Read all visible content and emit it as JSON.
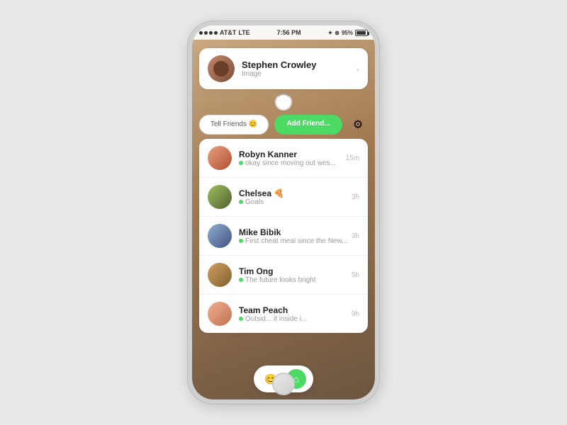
{
  "statusBar": {
    "carrier": "AT&T",
    "network": "LTE",
    "time": "7:56 PM",
    "battery": "95%"
  },
  "profileCard": {
    "name": "Stephen Crowley",
    "subtitle": "Image",
    "chevron": "›"
  },
  "actionButtons": {
    "tellFriends": "Tell Friends 😊",
    "addFriend": "Add Friend...",
    "settingsIcon": "⚙"
  },
  "friends": [
    {
      "name": "Robyn Kanner",
      "status": "okay since moving out wes...",
      "time": "15m",
      "avatarClass": "av-robyn"
    },
    {
      "name": "Chelsea 🍕",
      "status": "Goals",
      "time": "3h",
      "avatarClass": "av-chelsea"
    },
    {
      "name": "Mike Bibik",
      "status": "First cheat meal since the New...",
      "time": "3h",
      "avatarClass": "av-mike"
    },
    {
      "name": "Tim Ong",
      "status": "The future looks bright",
      "time": "5h",
      "avatarClass": "av-tim"
    },
    {
      "name": "Team Peach",
      "status": "Outsid... it inside i...",
      "time": "9h",
      "avatarClass": "av-peach"
    }
  ],
  "bottomNav": {
    "emojiIcon": "😊",
    "homeIcon": "⌂"
  }
}
